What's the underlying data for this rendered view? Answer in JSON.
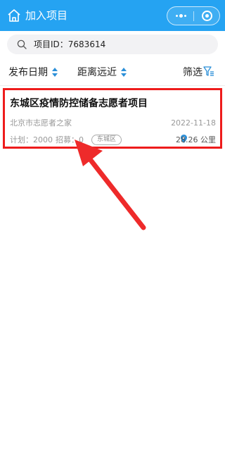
{
  "header": {
    "title": "加入项目",
    "home_icon": "home-icon",
    "more_icon": "more-dots-icon",
    "close_icon": "close-ring-icon",
    "background": "#25a3f2"
  },
  "search": {
    "value": "项目ID：7683614",
    "icon": "search-icon"
  },
  "filters": {
    "sort_date": "发布日期",
    "sort_distance": "距离远近",
    "filter": "筛选",
    "arrow_color": "#2b8fd8"
  },
  "project": {
    "title": "东城区疫情防控储备志愿者项目",
    "org": "北京市志愿者之家",
    "date": "2022-11-18",
    "plan": "计划：2000",
    "recruit": "招募：0",
    "district": "东城区",
    "distance": "28.26 公里",
    "highlight_color": "#ee1c1c"
  },
  "annotation": {
    "arrow_icon": "red-arrow-icon",
    "color": "#ee2a2a"
  }
}
